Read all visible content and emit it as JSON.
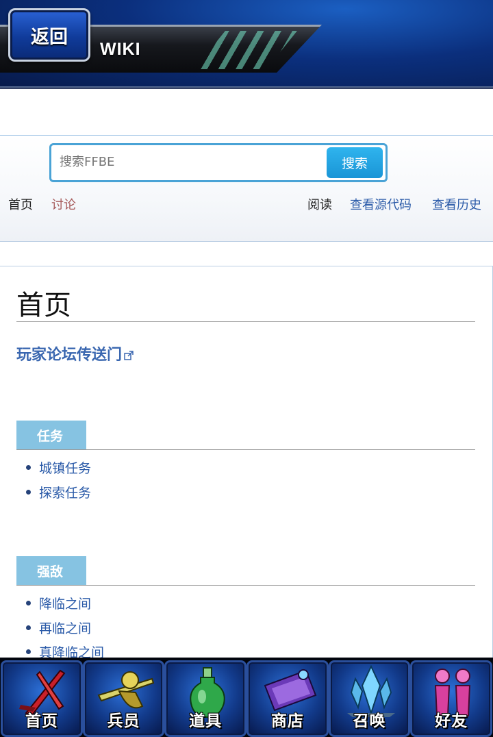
{
  "header": {
    "back_label": "返回",
    "wiki_title": "WIKI"
  },
  "search": {
    "placeholder": "搜索FFBE",
    "button_label": "搜索"
  },
  "tabs": {
    "home": "首页",
    "talk": "讨论",
    "read": "阅读",
    "view_source": "查看源代码",
    "view_history": "查看历史"
  },
  "main": {
    "page_title": "首页",
    "forum_link": "玩家论坛传送门",
    "sections": [
      {
        "heading": "任务",
        "items": [
          "城镇任务",
          "探索任务"
        ]
      },
      {
        "heading": "强敌",
        "items": [
          "降临之间",
          "再临之间",
          "真降临之间"
        ]
      }
    ]
  },
  "bottom_nav": [
    {
      "label": "首页",
      "icon": "sword-icon"
    },
    {
      "label": "兵员",
      "icon": "warrior-icon"
    },
    {
      "label": "道具",
      "icon": "potion-icon"
    },
    {
      "label": "商店",
      "icon": "shop-icon"
    },
    {
      "label": "召唤",
      "icon": "crystal-icon"
    },
    {
      "label": "好友",
      "icon": "friends-icon"
    }
  ],
  "colors": {
    "link": "#2a5aa8",
    "section_head": "#86c3e2",
    "search_button": "#1a95d6",
    "talk_tab": "#a55858"
  }
}
